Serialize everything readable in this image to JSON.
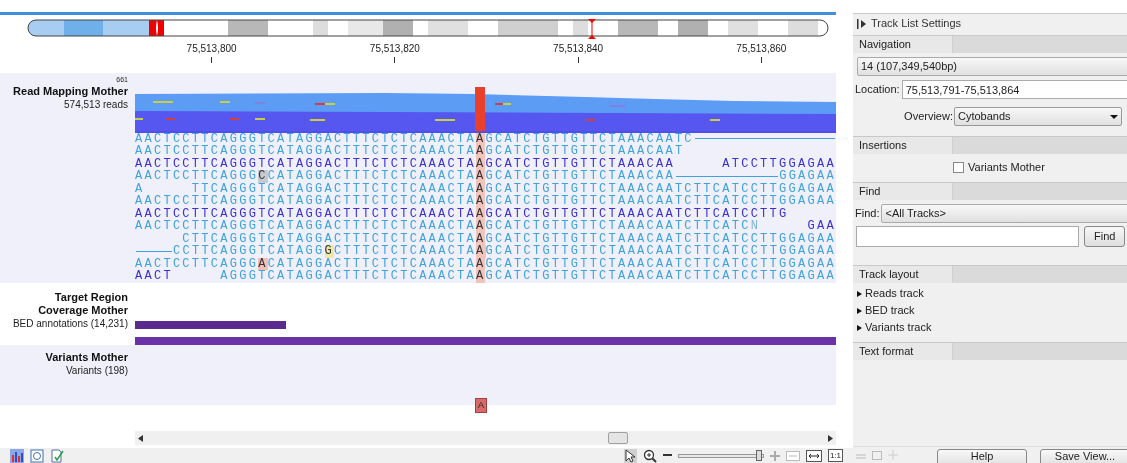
{
  "ruler": {
    "ticks": [
      "75,513,800",
      "75,513,820",
      "75,513,840",
      "75,513,860"
    ]
  },
  "tracks": [
    {
      "kind": "reads",
      "title": "Read Mapping Mother",
      "subtitle": "574,513 reads",
      "max_coverage": "661",
      "reads": [
        {
          "segments": [
            {
              "kind": "light",
              "text": "AACTCCTTCAGGGTCATAGGACTTTCTCTCAAACTA"
            },
            {
              "kind": "variant",
              "text": "A"
            },
            {
              "kind": "light",
              "text": "GCATCTGTTGTTCTAAACAATC"
            },
            {
              "kind": "line"
            }
          ]
        },
        {
          "segments": [
            {
              "kind": "light",
              "text": "AACTCCTTCAGGGTCATAGGACTTTCTCTCAAACTA"
            },
            {
              "kind": "variant",
              "text": "A"
            },
            {
              "kind": "light",
              "text": "GCATCTGTTGTTCTAAACAAT"
            }
          ]
        },
        {
          "segments": [
            {
              "kind": "dark",
              "text": "AACTCCTTCAGGGTCATAGGACTTTCTCTCAAACTA"
            },
            {
              "kind": "variant",
              "text": "A"
            },
            {
              "kind": "dark",
              "text": "GCATCTGTTGTTCTAAACAA     ATCCTTGGAGAA"
            }
          ]
        },
        {
          "segments": [
            {
              "kind": "light",
              "text": "AACTCCTTCAGGG"
            },
            {
              "kind": "mismatch",
              "text": "C",
              "color": "#c8c8d0"
            },
            {
              "kind": "light",
              "text": "CATAGGACTTTCTCTCAAACTA"
            },
            {
              "kind": "variant",
              "text": "A"
            },
            {
              "kind": "light",
              "text": "GCATCTGTTGTTCTAAACAA"
            },
            {
              "kind": "line"
            },
            {
              "kind": "light",
              "text": "GGAGAA"
            }
          ]
        },
        {
          "segments": [
            {
              "kind": "light",
              "text": "A     TTCAGGGTCATAGGACTTTCTCTCAAACTA"
            },
            {
              "kind": "variant",
              "text": "A"
            },
            {
              "kind": "light",
              "text": "GCATCTGTTGTTCTAAACAATCTTCATCCTTGGAGAA"
            }
          ]
        },
        {
          "segments": [
            {
              "kind": "light",
              "text": "AACTCCTTCAGGGTCATAGGACTTTCTCTCAAACTA"
            },
            {
              "kind": "variant",
              "text": "A"
            },
            {
              "kind": "light",
              "text": "GCATCTGTTGTTCTAAACAATCTTCATCCTTGGAGAA"
            }
          ]
        },
        {
          "segments": [
            {
              "kind": "dark",
              "text": "AACTCCTTCAGGGTCATAGGACTTTCTCTCAAACTA"
            },
            {
              "kind": "variant",
              "text": "A"
            },
            {
              "kind": "dark",
              "text": "GCATCTGTTGTTCTAAACAATCTTCATCCTTG"
            }
          ]
        },
        {
          "segments": [
            {
              "kind": "light",
              "text": "AACTCCTTCAGGGTCATAGGACTTTCTCTCAAACTA"
            },
            {
              "kind": "variant",
              "text": "A"
            },
            {
              "kind": "light",
              "text": "GCATCTGTTGTTCTAAACAATCTTCATC"
            },
            {
              "kind": "faint",
              "text": "N"
            },
            {
              "kind": "dark",
              "text": "     GAA"
            }
          ]
        },
        {
          "segments": [
            {
              "kind": "light",
              "text": "     CTTCAGGGTCATAGGACTTTCTCTCAAACTA"
            },
            {
              "kind": "variant",
              "text": "A"
            },
            {
              "kind": "light",
              "text": "GCATCTGTTGTTCTAAACAATCTTCATCCTTGGAGAA"
            }
          ]
        },
        {
          "segments": [
            {
              "kind": "line"
            },
            {
              "kind": "light",
              "text": "CCTTCAGGGTCATAGG"
            },
            {
              "kind": "mismatch",
              "text": "G",
              "color": "#ece8a8"
            },
            {
              "kind": "light",
              "text": "CTTTCTCTCAAACTA"
            },
            {
              "kind": "variant",
              "text": "A"
            },
            {
              "kind": "light",
              "text": "GCATCTGTTGTTCTAAACAATCTTCATCCTTGGAGAA"
            }
          ]
        },
        {
          "segments": [
            {
              "kind": "light",
              "text": "AACTCCTTCAGGG"
            },
            {
              "kind": "mismatch",
              "text": "A",
              "color": "#f2c0b8"
            },
            {
              "kind": "light",
              "text": "CATAGGACTTTCTCTCAAACTA"
            },
            {
              "kind": "variant",
              "text": "A"
            },
            {
              "kind": "light",
              "text": "GCATCTGTTGTTCTAAACAATCTTCATCCTTGGAGAA"
            }
          ]
        },
        {
          "segments": [
            {
              "kind": "dark",
              "text": "AACT"
            },
            {
              "kind": "light",
              "text": "     AGGGTCATAGGACTTTCTCTCAAACTA"
            },
            {
              "kind": "variant",
              "text": "A"
            },
            {
              "kind": "light",
              "text": "GCATCTGTTGTTCTAAACAATCTTCATCCTTGGAGAA"
            }
          ]
        }
      ]
    },
    {
      "kind": "annotations",
      "title": "Target Region Coverage Mother",
      "subtitle": "BED annotations (14,231)"
    },
    {
      "kind": "variants",
      "title": "Variants Mother",
      "subtitle": "Variants (198)",
      "variant": "A"
    }
  ],
  "zoom_slider": {
    "level": 0.95
  },
  "zoom_ratio": "1:1",
  "settings": {
    "title": "Track List Settings",
    "sections": [
      {
        "kind": "navigation",
        "header": "Navigation",
        "chromosome": "14 (107,349,540bp)",
        "location_label": "Location:",
        "location": "75,513,791-75,513,864",
        "overview_label": "Overview:",
        "overview": "Cytobands"
      },
      {
        "kind": "insertions",
        "header": "Insertions",
        "checkbox": {
          "label": "Variants Mother",
          "checked": false
        }
      },
      {
        "kind": "find",
        "header": "Find",
        "find_label": "Find:",
        "scope": "<All Tracks>",
        "button": "Find"
      },
      {
        "kind": "layout",
        "header": "Track layout",
        "items": [
          {
            "label": "Reads track",
            "expanded": false
          },
          {
            "label": "BED track",
            "expanded": false
          },
          {
            "label": "Variants track",
            "expanded": false
          }
        ]
      },
      {
        "kind": "text_format",
        "header": "Text format"
      }
    ],
    "buttons": [
      "Help",
      "Save View..."
    ]
  }
}
